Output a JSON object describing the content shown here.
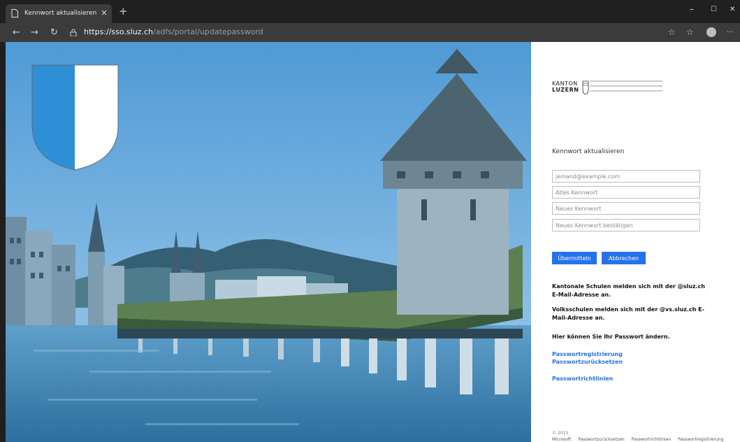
{
  "browser": {
    "tab_title": "Kennwort aktualisieren",
    "tab_close": "×",
    "new_tab": "+",
    "url_host": "https://sso.sluz.ch",
    "url_path": "/adfs/portal/updatepassword",
    "window_controls": {
      "minimize": "–",
      "maximize": "☐",
      "close": "✕"
    },
    "nav": {
      "back": "←",
      "forward": "→",
      "refresh": "↻"
    },
    "tools": {
      "favorite": "☆",
      "favorites": "☆",
      "more": "···"
    }
  },
  "logo": {
    "line1": "KANTON",
    "line2": "LUZERN"
  },
  "form": {
    "heading": "Kennwort aktualisieren",
    "email_placeholder": "jemand@example.com",
    "old_password_placeholder": "Altes Kennwort",
    "new_password_placeholder": "Neues Kennwort",
    "confirm_password_placeholder": "Neues Kennwort bestätigen",
    "submit_label": "Übermitteln",
    "cancel_label": "Abbrechen"
  },
  "notes": {
    "schools": "Kantonale Schulen melden sich mit der @sluz.ch E-Mail-Adresse an.",
    "volksschulen": "Volksschulen melden sich mit der @vs.sluz.ch E-Mail-Adresse an.",
    "change": "Hier können Sie Ihr Passwort ändern."
  },
  "links": {
    "registration": "Passwortregistrierung",
    "reset": "Passwortzurücksetzen",
    "policies": "Passwortrichtlinien"
  },
  "footer": {
    "copyright": "© 2013",
    "items": [
      "Microsoft",
      "Passwortzurücksetzen",
      "Passwortrichtlinien",
      "Passwortregistrierung"
    ]
  },
  "colors": {
    "accent": "#2672ec",
    "shield_blue": "#2f8fd6",
    "chrome_dark": "#202020"
  }
}
